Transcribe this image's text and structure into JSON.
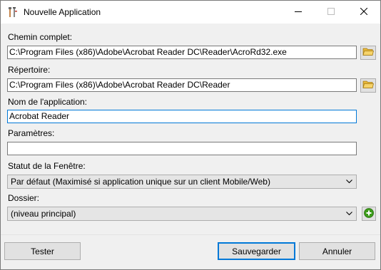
{
  "window": {
    "title": "Nouvelle Application",
    "icon": "tools-icon",
    "minimize_icon": "minimize-icon",
    "maximize_icon": "maximize-icon",
    "close_icon": "close-icon"
  },
  "form": {
    "full_path_label": "Chemin complet:",
    "full_path_value": "C:\\Program Files (x86)\\Adobe\\Acrobat Reader DC\\Reader\\AcroRd32.exe",
    "directory_label": "Répertoire:",
    "directory_value": "C:\\Program Files (x86)\\Adobe\\Acrobat Reader DC\\Reader",
    "app_name_label": "Nom de l'application:",
    "app_name_value": "Acrobat Reader",
    "params_label": "Paramètres:",
    "params_value": "",
    "window_state_label": "Statut de la Fenêtre:",
    "window_state_value": "Par défaut (Maximisé si application unique sur un client Mobile/Web)",
    "folder_label": "Dossier:",
    "folder_value": "(niveau principal)",
    "browse_icon": "folder-icon",
    "add_icon": "plus-circle-icon"
  },
  "buttons": {
    "test": "Tester",
    "save": "Sauvegarder",
    "cancel": "Annuler"
  },
  "colors": {
    "focus_border": "#0078d7",
    "add_green": "#3c9c1a",
    "folder_yellow": "#e8b838"
  }
}
